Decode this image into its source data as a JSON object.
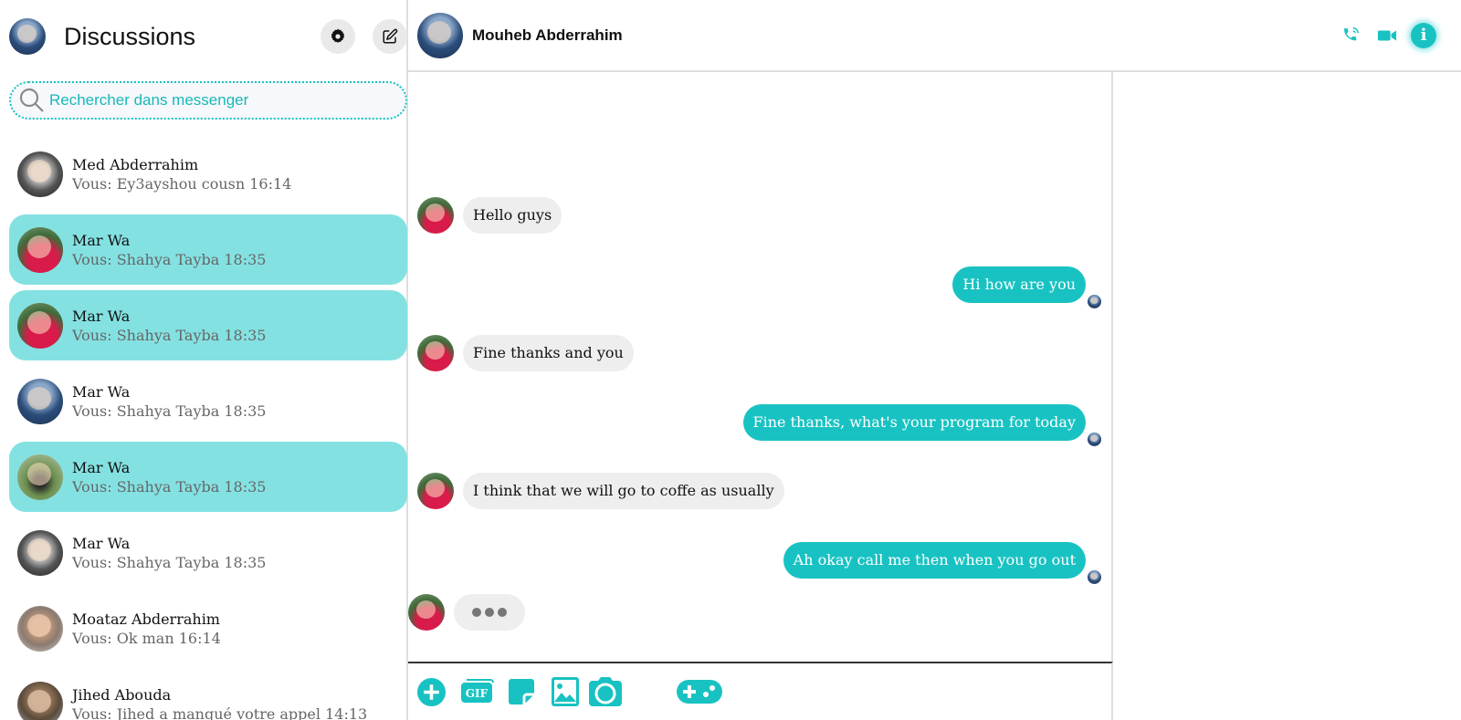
{
  "sidebar": {
    "title": "Discussions",
    "search_placeholder": "Rechercher dans messenger",
    "conversations": [
      {
        "name": "Med Abderrahim",
        "preview": "Vous: Ey3ayshou cousn 16:14",
        "avatar": "man-bw",
        "active": false
      },
      {
        "name": "Mar Wa",
        "preview": "Vous: Shahya Tayba 18:35",
        "avatar": "woman-red",
        "active": true
      },
      {
        "name": "Mar Wa",
        "preview": "Vous: Shahya Tayba 18:35",
        "avatar": "woman-red",
        "active": true
      },
      {
        "name": "Mar Wa",
        "preview": "Vous: Shahya Tayba 18:35",
        "avatar": "man-blue",
        "active": false
      },
      {
        "name": "Mar Wa",
        "preview": "Vous: Shahya Tayba 18:35",
        "avatar": "park",
        "active": true
      },
      {
        "name": "Mar Wa",
        "preview": "Vous: Shahya Tayba 18:35",
        "avatar": "man-bw",
        "active": false
      },
      {
        "name": "Moataz Abderrahim",
        "preview": "Vous: Ok man 16:14",
        "avatar": "moataz",
        "active": false
      },
      {
        "name": "Jihed Abouda",
        "preview": "Vous: Jihed a manqué votre appel 14:13",
        "avatar": "jihed",
        "active": false
      }
    ]
  },
  "chat": {
    "contact_name": "Mouheb Abderrahim",
    "messages": [
      {
        "direction": "in",
        "text": "Hello guys"
      },
      {
        "direction": "out",
        "text": "Hi how are you"
      },
      {
        "direction": "in",
        "text": "Fine thanks and you"
      },
      {
        "direction": "out",
        "text": "Fine thanks, what's your program for today"
      },
      {
        "direction": "in",
        "text": "I think that we will go to coffe as usually"
      },
      {
        "direction": "out",
        "text": "Ah okay call me then when you go out"
      }
    ],
    "typing_indicator": true
  },
  "composer": {
    "gif_label": "GIF"
  },
  "colors": {
    "accent": "#19c2c2",
    "active_conversation": "#84e1e2",
    "incoming_bubble": "#eeeeee",
    "outgoing_bubble": "#19c2c2"
  },
  "icons": [
    "settings-icon",
    "new-message-icon",
    "search-icon",
    "phone-icon",
    "video-icon",
    "info-icon",
    "add-icon",
    "gif-icon",
    "sticker-icon",
    "image-icon",
    "camera-icon",
    "game-icon"
  ]
}
